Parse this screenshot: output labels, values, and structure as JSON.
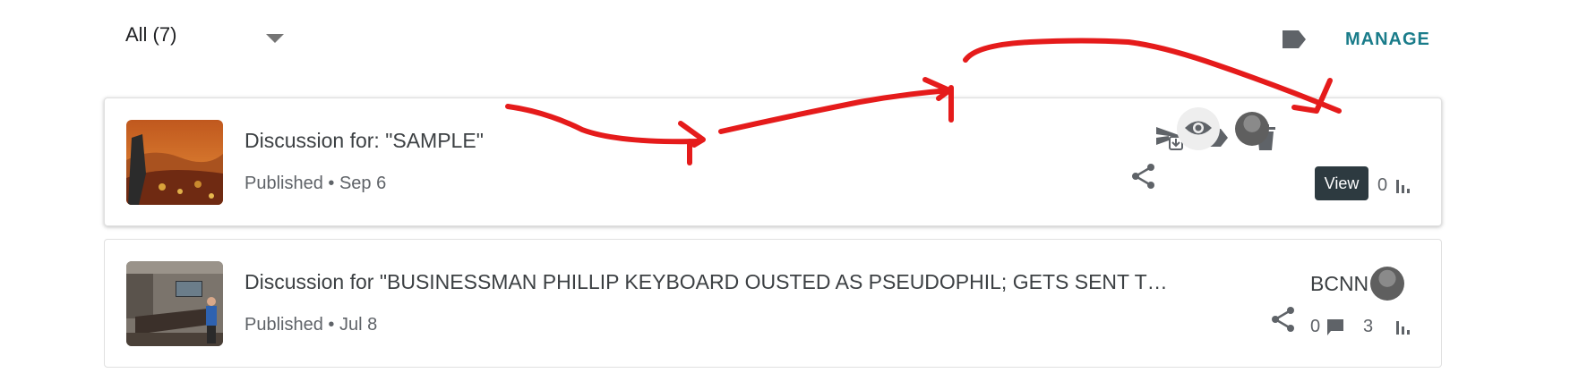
{
  "filter": {
    "label": "All (7)"
  },
  "header": {
    "manage_label": "MANAGE"
  },
  "posts": [
    {
      "title": "Discussion for: \"SAMPLE\"",
      "status_line": "Published • Sep 6",
      "tooltip": "View",
      "stats_count": "0"
    },
    {
      "title": "Discussion for \"BUSINESSMAN PHILLIP KEYBOARD OUSTED AS PSEUDOPHIL; GETS SENT T…",
      "status_line": "Published • Jul 8",
      "source": "BCNN",
      "comments_count": "0",
      "stats_count": "3"
    }
  ],
  "colors": {
    "accent": "#1a7c8a",
    "icon": "#5f6368",
    "annotation": "#e51b1b",
    "tooltip_bg": "#2d3a40"
  },
  "icons": [
    "chevron-down-icon",
    "label-icon",
    "send-download-icon",
    "trash-icon",
    "eye-icon",
    "share-icon",
    "stats-icon",
    "comment-icon"
  ]
}
